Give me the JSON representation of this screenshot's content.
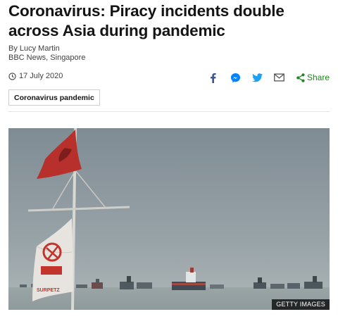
{
  "article": {
    "headline": "Coronavirus: Piracy incidents double across Asia during pandemic",
    "author": "By Lucy Martin",
    "author_role": "BBC News, Singapore",
    "date": "17 July 2020"
  },
  "share": {
    "icons": [
      "facebook-icon",
      "messenger-icon",
      "twitter-icon",
      "email-icon",
      "share-icon"
    ],
    "label": "Share",
    "colors": {
      "facebook": "#3b5998",
      "messenger": "#0084ff",
      "twitter": "#1da1f2",
      "email": "#555555",
      "share": "#1a8a1a"
    }
  },
  "topic_tag": "Coronavirus pandemic",
  "image": {
    "credit": "GETTY IMAGES",
    "flag_emblem_text": "SURPETZ"
  }
}
